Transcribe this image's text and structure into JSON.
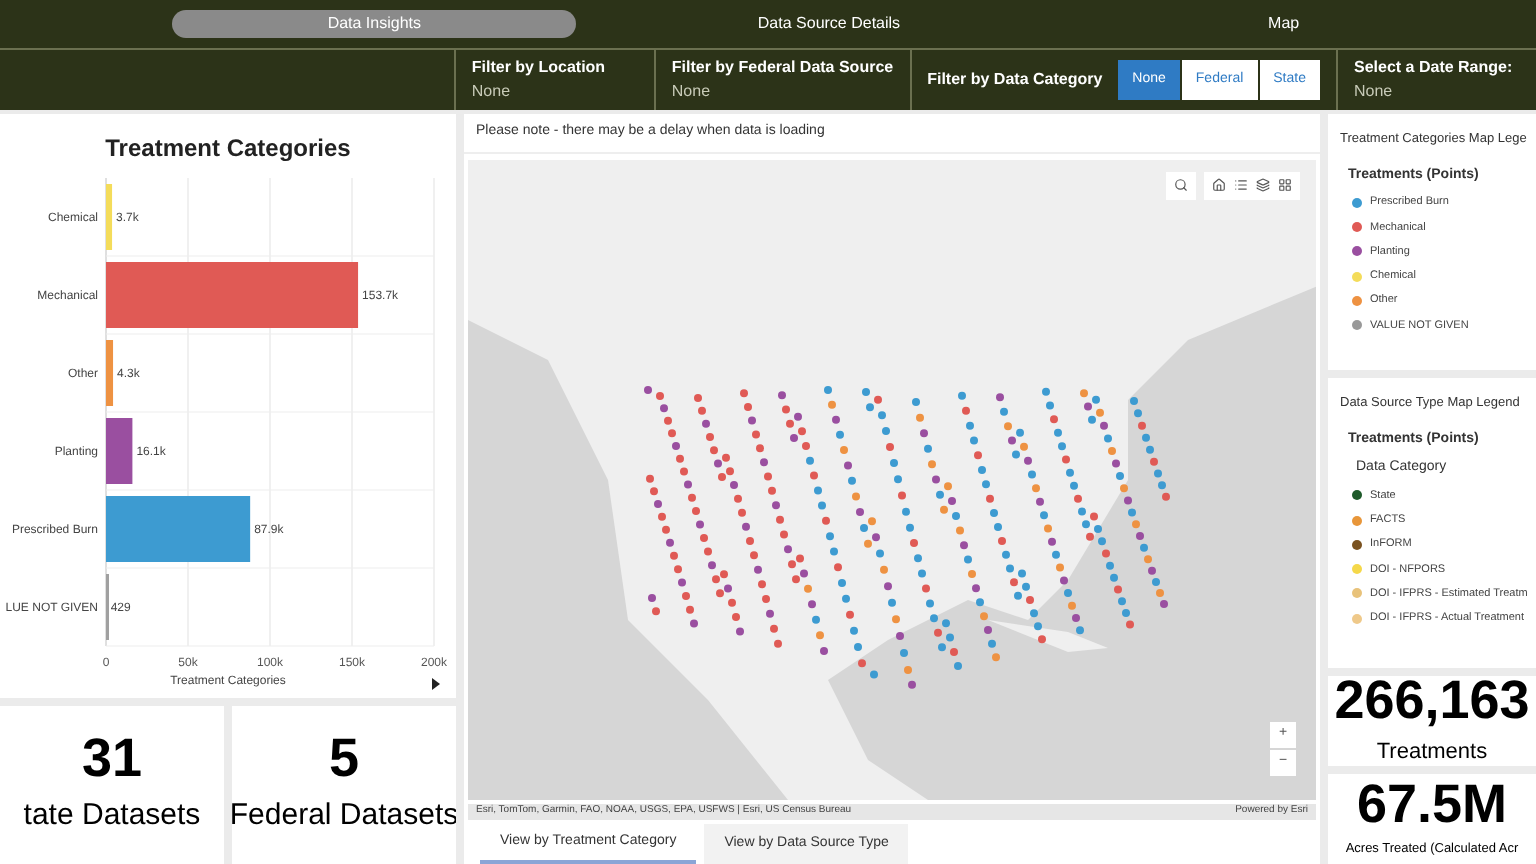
{
  "nav_tabs": [
    {
      "label": "Data Insights",
      "selected": true
    },
    {
      "label": "Data Source Details",
      "selected": false
    },
    {
      "label": "Map",
      "selected": false
    }
  ],
  "filters": [
    {
      "kind": "value",
      "label": "Filter by Location",
      "value": "None"
    },
    {
      "kind": "value",
      "label": "Filter by Federal Data Source",
      "value": "None"
    },
    {
      "kind": "toggle",
      "label": "Filter by Data Category",
      "options": [
        {
          "label": "None",
          "selected": true
        },
        {
          "label": "Federal",
          "selected": false
        },
        {
          "label": "State",
          "selected": false
        }
      ]
    },
    {
      "kind": "value",
      "label": "Select a Date Range:",
      "value": "None"
    }
  ],
  "chart_panel": {
    "title": "Treatment Categories",
    "chart_data": {
      "type": "bar",
      "orientation": "horizontal",
      "grid": true,
      "categories": [
        "Chemical",
        "Mechanical",
        "Other",
        "Planting",
        "Prescribed Burn",
        "LUE NOT GIVEN"
      ],
      "series": [
        {
          "name": "Treatment Categories",
          "colors": [
            "#f4dc5a",
            "#e05a55",
            "#ee9242",
            "#9a4fa0",
            "#3d9bd1",
            "#a0a0a0"
          ],
          "values": [
            3700,
            153700,
            4300,
            16100,
            87900,
            429
          ]
        }
      ],
      "value_labels": [
        "3.7k",
        "153.7k",
        "4.3k",
        "16.1k",
        "87.9k",
        "429"
      ],
      "xlim": [
        0,
        200000
      ],
      "xticks": [
        {
          "value": 0,
          "label": "0"
        },
        {
          "value": 50000,
          "label": "50k"
        },
        {
          "value": 100000,
          "label": "100k"
        },
        {
          "value": 150000,
          "label": "150k"
        },
        {
          "value": 200000,
          "label": "200k"
        }
      ]
    }
  },
  "stats_left": [
    {
      "value": "31",
      "label": "tate Datasets"
    },
    {
      "value": "5",
      "label": "Federal Datasets"
    }
  ],
  "map": {
    "note": "Please note - there may be a delay when data is loading",
    "attribution": "Esri, TomTom, Garmin, FAO, NOAA, USGS, EPA, USFWS | Esri, US Census Bureau",
    "powered_by": "Powered by Esri",
    "zoom_in": "+",
    "zoom_out": "−",
    "tabs": [
      {
        "label": "View by Treatment Category",
        "selected": true
      },
      {
        "label": "View by Data Source Type",
        "selected": false
      }
    ]
  },
  "legends": [
    {
      "title": "Treatment Categories Map Lege",
      "layer": "Treatments (Points)",
      "items": [
        {
          "label": "Prescribed Burn",
          "color": "#3d9bd1"
        },
        {
          "label": "Mechanical",
          "color": "#e05a55"
        },
        {
          "label": "Planting",
          "color": "#9a4fa0"
        },
        {
          "label": "Chemical",
          "color": "#f4dc5a"
        },
        {
          "label": "Other",
          "color": "#ee9242"
        },
        {
          "label": "VALUE NOT GIVEN",
          "color": "#999999"
        }
      ]
    },
    {
      "title": "Data Source Type Map Legend",
      "layer": "Treatments (Points)",
      "group": "Data Category",
      "items": [
        {
          "label": "State",
          "color": "#1e5a2a"
        },
        {
          "label": "FACTS",
          "color": "#e8963a"
        },
        {
          "label": "InFORM",
          "color": "#7a5220"
        },
        {
          "label": "DOI - NFPORS",
          "color": "#f5d84a"
        },
        {
          "label": "DOI - IFPRS - Estimated Treatm",
          "color": "#e8c27a"
        },
        {
          "label": "DOI - IFPRS - Actual Treatment",
          "color": "#efc98a"
        }
      ]
    }
  ],
  "stats_right": [
    {
      "value": "266,163",
      "label": "Treatments"
    },
    {
      "value": "67.5M",
      "label": "Acres Treated (Calculated Acr"
    }
  ]
}
